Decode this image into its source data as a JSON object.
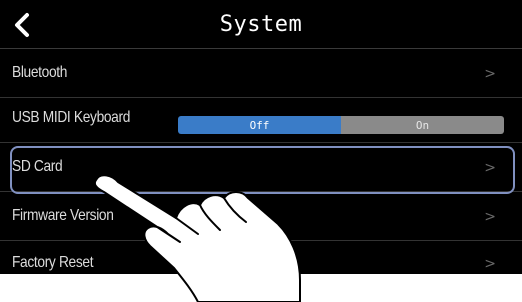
{
  "header": {
    "title": "System",
    "back_icon": "chevron-left-icon"
  },
  "rows": [
    {
      "label": "Bluetooth",
      "chevron": ">"
    },
    {
      "label": "USB MIDI Keyboard",
      "toggle": {
        "off": "Off",
        "on": "On",
        "selected": "Off"
      }
    },
    {
      "label": "SD Card",
      "chevron": ">",
      "selected": true
    },
    {
      "label": "Firmware Version",
      "chevron": ">"
    },
    {
      "label": "Factory Reset",
      "chevron": ">"
    }
  ],
  "colors": {
    "background": "#000000",
    "toggle_off_active": "#3a7cc8",
    "toggle_on_inactive": "#8a8a8a",
    "selection_border": "#8090c0"
  },
  "overlay": {
    "icon": "pointing-hand-icon"
  }
}
